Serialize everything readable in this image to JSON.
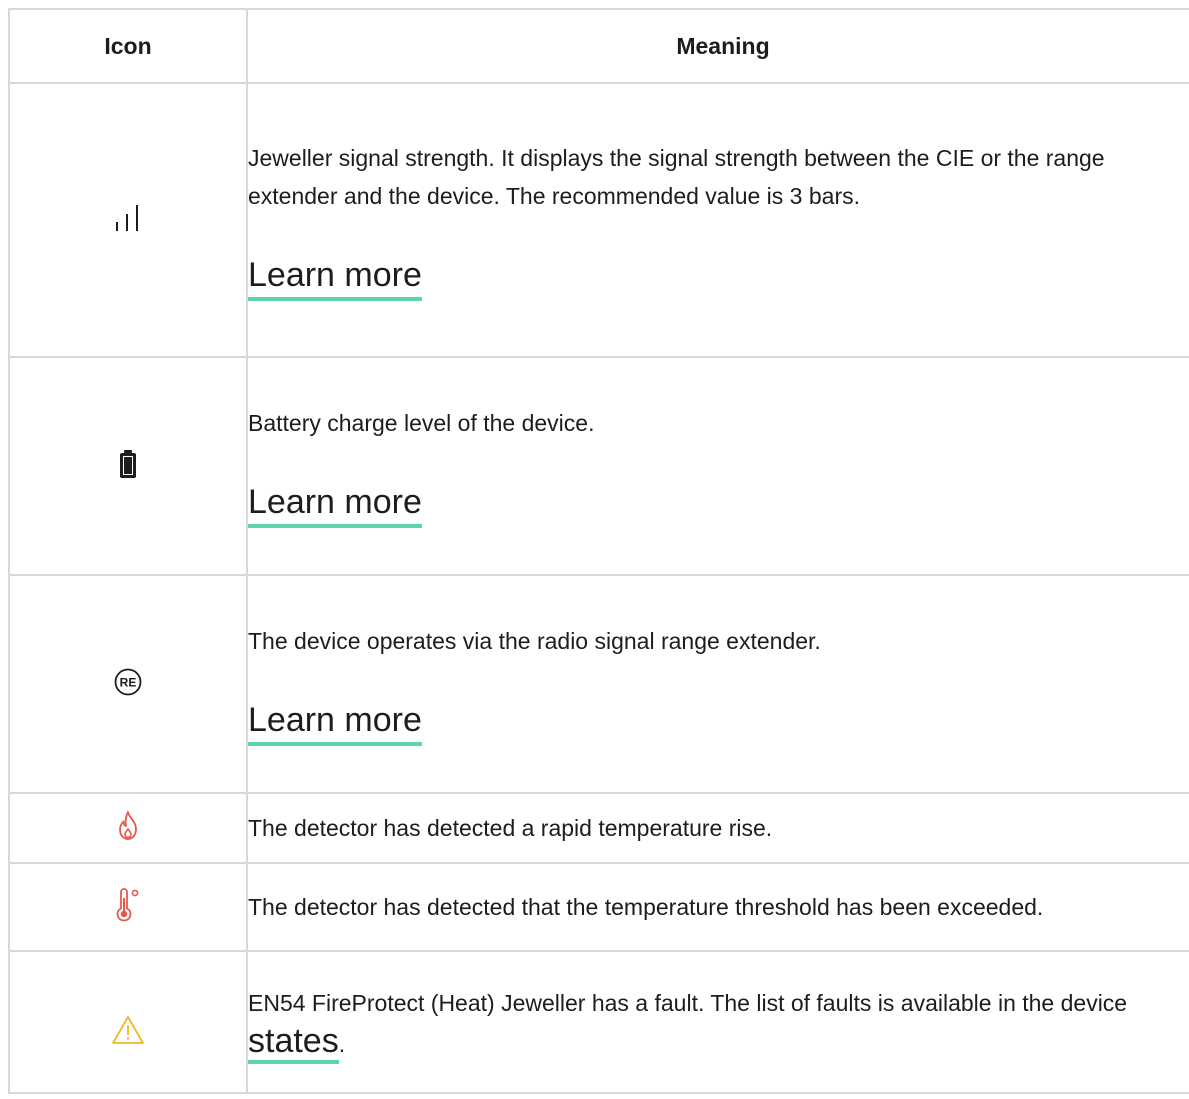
{
  "table": {
    "headers": {
      "icon": "Icon",
      "meaning": "Meaning"
    },
    "rows": [
      {
        "icon": "signal-strength-icon",
        "text": "Jeweller signal strength. It displays the signal strength between the CIE or the range extender and the device. The recommended value is 3 bars.",
        "link": "Learn more"
      },
      {
        "icon": "battery-icon",
        "text": "Battery charge level of the device.",
        "link": "Learn more"
      },
      {
        "icon": "range-extender-icon",
        "icon_text": "RE",
        "text": "The device operates via the radio signal range extender.",
        "link": "Learn more"
      },
      {
        "icon": "flame-icon",
        "text": "The detector has detected a rapid temperature rise."
      },
      {
        "icon": "thermometer-icon",
        "text": "The detector has detected that the temperature threshold has been exceeded."
      },
      {
        "icon": "warning-icon",
        "text_before": "EN54 FireProtect (Heat) Jeweller has a fault. The list of faults is available in the device ",
        "link": "states",
        "text_after": "."
      }
    ]
  },
  "colors": {
    "text": "#1d1d1f",
    "border": "#d8d8d8",
    "link_underline": "#5ad6a6",
    "alarm_red": "#e8584a",
    "warning_yellow": "#f2b822"
  }
}
